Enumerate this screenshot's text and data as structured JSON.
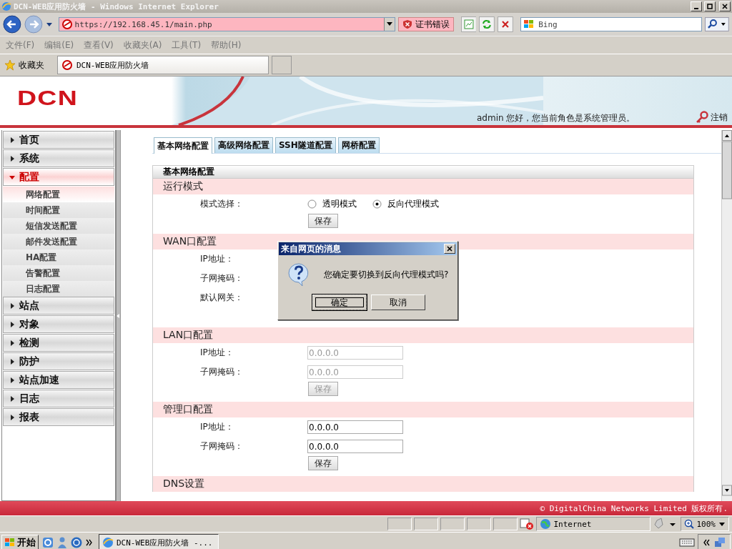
{
  "browser": {
    "title": "DCN-WEB应用防火墙 - Windows Internet Explorer",
    "url": "https://192.168.45.1/main.php",
    "cert_error": "证书错误",
    "search_placeholder": "Bing",
    "menu": [
      "文件(F)",
      "编辑(E)",
      "查看(V)",
      "收藏夹(A)",
      "工具(T)",
      "帮助(H)"
    ],
    "favorites": "收藏夹",
    "tab": "DCN-WEB应用防火墙"
  },
  "header": {
    "logo": "DCN",
    "greeting": "admin 您好，您当前角色是系统管理员。",
    "logout": "注销"
  },
  "sidebar": [
    {
      "label": "首页",
      "expanded": false
    },
    {
      "label": "系统",
      "expanded": false
    },
    {
      "label": "配置",
      "expanded": true,
      "children": [
        {
          "label": "网络配置",
          "selected": true
        },
        {
          "label": "时间配置",
          "selected": false
        },
        {
          "label": "短信发送配置",
          "selected": false
        },
        {
          "label": "邮件发送配置",
          "selected": false
        },
        {
          "label": "HA配置",
          "selected": false
        },
        {
          "label": "告警配置",
          "selected": false
        },
        {
          "label": "日志配置",
          "selected": false
        }
      ]
    },
    {
      "label": "站点",
      "expanded": false
    },
    {
      "label": "对象",
      "expanded": false
    },
    {
      "label": "检测",
      "expanded": false
    },
    {
      "label": "防护",
      "expanded": false
    },
    {
      "label": "站点加速",
      "expanded": false
    },
    {
      "label": "日志",
      "expanded": false
    },
    {
      "label": "报表",
      "expanded": false
    }
  ],
  "tabs": [
    {
      "label": "基本网络配置",
      "selected": true
    },
    {
      "label": "高级网络配置",
      "selected": false
    },
    {
      "label": "SSH隧道配置",
      "selected": false
    },
    {
      "label": "网桥配置",
      "selected": false
    }
  ],
  "panel": {
    "title": "基本网络配置",
    "sections": [
      {
        "heading": "运行模式",
        "rows": [
          {
            "kind": "radio",
            "label": "模式选择：",
            "options": [
              {
                "label": "透明模式",
                "selected": false
              },
              {
                "label": "反向代理模式",
                "selected": true
              }
            ]
          }
        ],
        "save": "保存",
        "save_disabled": false
      },
      {
        "heading": "WAN口配置",
        "rows": [
          {
            "kind": "label",
            "label": "IP地址："
          },
          {
            "kind": "label",
            "label": "子网掩码："
          },
          {
            "kind": "label",
            "label": "默认网关："
          }
        ]
      },
      {
        "heading": "LAN口配置",
        "rows": [
          {
            "kind": "field",
            "label": "IP地址：",
            "value": "0.0.0.0",
            "disabled": true
          },
          {
            "kind": "field",
            "label": "子网掩码：",
            "value": "0.0.0.0",
            "disabled": true
          }
        ],
        "save": "保存",
        "save_disabled": true
      },
      {
        "heading": "管理口配置",
        "rows": [
          {
            "kind": "field",
            "label": "IP地址：",
            "value": "0.0.0.0",
            "disabled": false
          },
          {
            "kind": "field",
            "label": "子网掩码：",
            "value": "0.0.0.0",
            "disabled": false
          }
        ],
        "save": "保存",
        "save_disabled": false
      },
      {
        "heading": "DNS设置"
      }
    ]
  },
  "footer": "© DigitalChina Networks Limited 版权所有.",
  "dialog": {
    "title": "来自网页的消息",
    "message": "您确定要切换到反向代理模式吗?",
    "buttons": [
      {
        "label": "确定",
        "focused": true
      },
      {
        "label": "取消",
        "focused": false
      }
    ]
  },
  "status_bar": {
    "zone": "Internet",
    "zoom": "100%"
  },
  "taskbar": {
    "start": "开始",
    "task": "DCN-WEB应用防火墙 -..."
  }
}
